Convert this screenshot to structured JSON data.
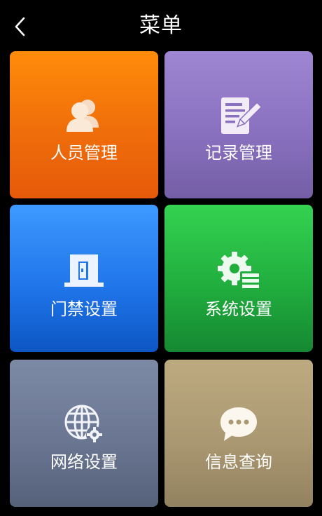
{
  "header": {
    "title": "菜单",
    "back_icon": "chevron-left-icon"
  },
  "menu": {
    "tiles": [
      {
        "label": "人员管理",
        "icon": "users-icon",
        "color": "#ef6d0a"
      },
      {
        "label": "记录管理",
        "icon": "edit-document-icon",
        "color": "#8a71c0"
      },
      {
        "label": "门禁设置",
        "icon": "door-icon",
        "color": "#2076ea"
      },
      {
        "label": "系统设置",
        "icon": "settings-gear-icon",
        "color": "#21ae3e"
      },
      {
        "label": "网络设置",
        "icon": "globe-settings-icon",
        "color": "#6a7692"
      },
      {
        "label": "信息查询",
        "icon": "chat-bubble-icon",
        "color": "#aa9872"
      }
    ]
  }
}
